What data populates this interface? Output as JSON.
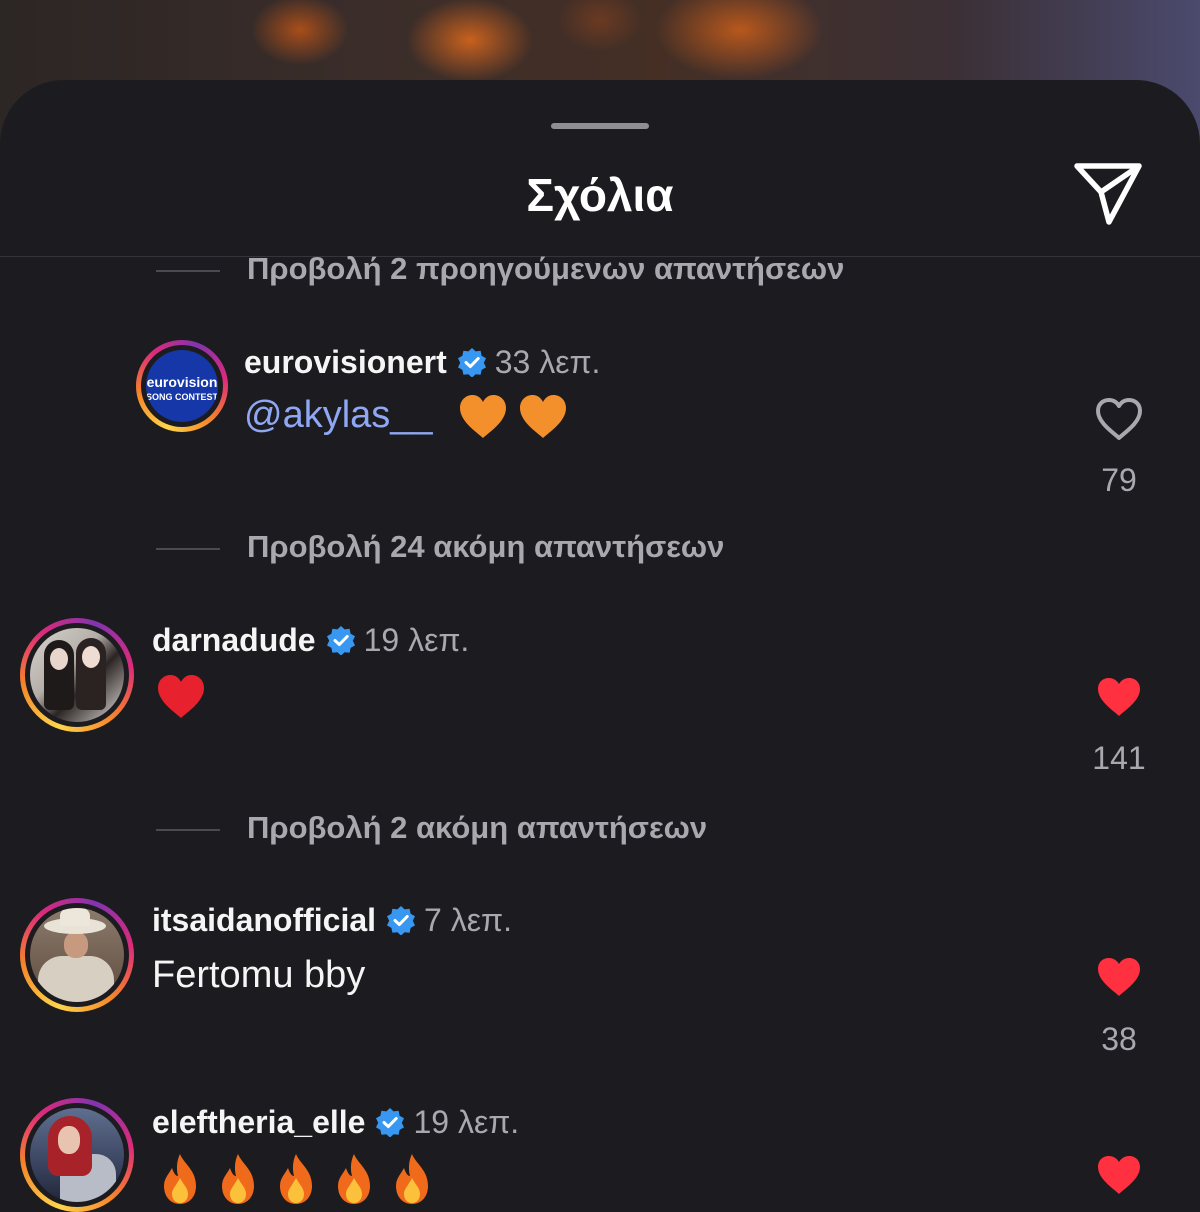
{
  "sheet": {
    "title": "Σχόλια"
  },
  "comments": [
    {
      "view_replies": "Προβολή 2 προηγούμενων απαντήσεων",
      "username": "eurovisionert",
      "time": "33 λεπ.",
      "mention": "@akylas__",
      "emoji": [
        "orange-heart",
        "orange-heart"
      ],
      "likes": "79",
      "liked": false,
      "avatar_logo_line1": "eurovision",
      "avatar_logo_line2": "SONG CONTEST"
    },
    {
      "view_replies": "Προβολή 24 ακόμη απαντήσεων",
      "username": "darnadude",
      "time": "19 λεπ.",
      "emoji": [
        "red-heart"
      ],
      "likes": "141",
      "liked": true
    },
    {
      "view_replies": "Προβολή 2 ακόμη απαντήσεων",
      "username": "itsaidanofficial",
      "time": "7 λεπ.",
      "text": "Fertomu bby",
      "likes": "38",
      "liked": true
    },
    {
      "username": "eleftheria_elle",
      "time": "19 λεπ.",
      "emoji": [
        "fire",
        "fire",
        "fire",
        "fire",
        "fire"
      ],
      "liked": true
    }
  ],
  "colors": {
    "background": "#1c1c20",
    "verified_blue": "#3897f0",
    "liked_red": "#ff3040",
    "mention_blue": "#8fa8f4",
    "secondary_text": "#a8a8ae"
  }
}
